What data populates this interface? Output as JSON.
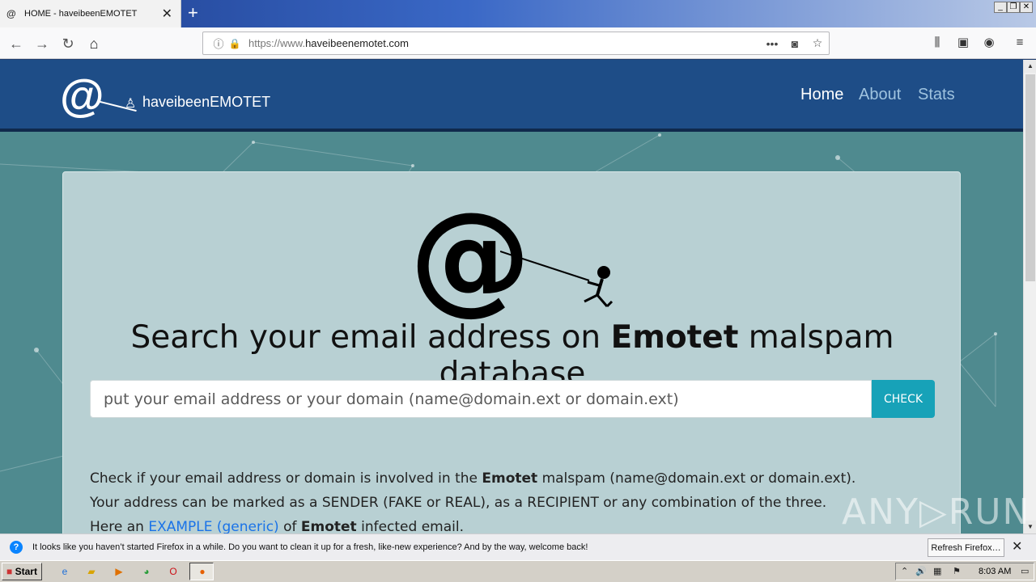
{
  "browser": {
    "tab_favicon": "@",
    "tab_title": "HOME - haveibeenEMOTET",
    "url_scheme": "https://www.",
    "url_host": "haveibeenemotet.com",
    "icons": [
      "back-icon",
      "forward-icon",
      "reload-icon",
      "home-icon",
      "info-icon",
      "lock-icon",
      "page-actions-icon",
      "pocket-icon",
      "bookmark-star-icon",
      "library-icon",
      "sidebar-icon",
      "account-icon",
      "menu-icon"
    ]
  },
  "site": {
    "brand_name": "haveibeenEMOTET",
    "nav": [
      {
        "label": "Home",
        "active": true
      },
      {
        "label": "About",
        "active": false
      },
      {
        "label": "Stats",
        "active": false
      }
    ],
    "headline_pre": "Search your email address on ",
    "headline_bold": "Emotet",
    "headline_post": " malspam database",
    "search_placeholder": "put your email address or your domain (name@domain.ext or domain.ext)",
    "check_label": "CHECK",
    "desc_line1_pre": "Check if your email address or domain is involved in the ",
    "desc_line1_bold": "Emotet",
    "desc_line1_post": " malspam (name@domain.ext or domain.ext).",
    "desc_line2": "Your address can be marked as a SENDER (FAKE or REAL), as a RECIPIENT or any combination of the three.",
    "desc_line3_pre": "Here an ",
    "desc_line3_link": "EXAMPLE (generic)",
    "desc_line3_mid": " of ",
    "desc_line3_bold": "Emotet",
    "desc_line3_post": " infected email."
  },
  "watermark": "ANY▷RUN",
  "notification": {
    "text": "It looks like you haven’t started Firefox in a while. Do you want to clean it up for a fresh, like-new experience? And by the way, welcome back!",
    "button": "Refresh Firefox…"
  },
  "taskbar": {
    "start_label": "Start",
    "clock": "8:03 AM"
  },
  "colors": {
    "header_bg": "#1e4d87",
    "page_bg": "#4f8a8f",
    "card_bg": "#b8d0d3",
    "check_btn": "#17a2b8",
    "link": "#1a73e8"
  }
}
